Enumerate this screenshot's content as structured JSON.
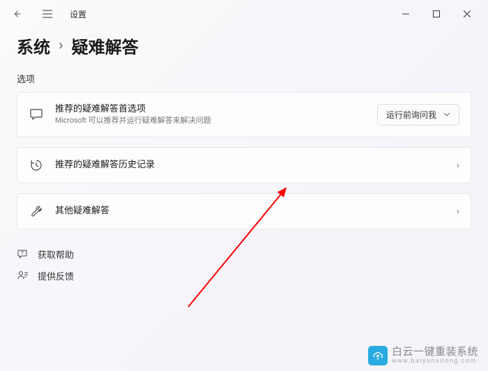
{
  "titlebar": {
    "app_name": "设置"
  },
  "breadcrumb": {
    "parent": "系统",
    "current": "疑难解答"
  },
  "section_label": "选项",
  "cards": {
    "recommended": {
      "title": "推荐的疑难解答首选项",
      "subtitle": "Microsoft 可以推荐并运行疑难解答来解决问题",
      "dropdown": "运行前询问我"
    },
    "history": {
      "title": "推荐的疑难解答历史记录"
    },
    "other": {
      "title": "其他疑难解答"
    }
  },
  "footer": {
    "help": "获取帮助",
    "feedback": "提供反馈"
  },
  "watermark": {
    "text": "白云一键重装系统",
    "url": "www.baiyunxitong.com"
  }
}
